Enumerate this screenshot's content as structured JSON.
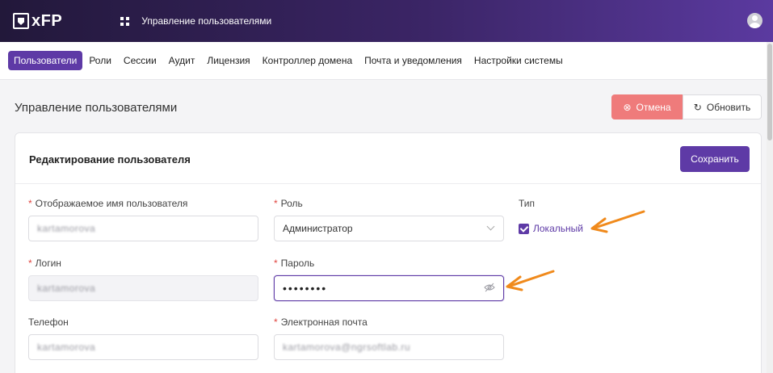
{
  "header": {
    "logo_text": "xFP",
    "app_title": "Управление пользователями"
  },
  "nav": {
    "items": [
      {
        "label": "Пользователи",
        "active": true
      },
      {
        "label": "Роли"
      },
      {
        "label": "Сессии"
      },
      {
        "label": "Аудит"
      },
      {
        "label": "Лицензия"
      },
      {
        "label": "Контроллер домена"
      },
      {
        "label": "Почта и уведомления"
      },
      {
        "label": "Настройки системы"
      }
    ]
  },
  "page": {
    "title": "Управление пользователями",
    "cancel_label": "Отмена",
    "refresh_label": "Обновить"
  },
  "card": {
    "title": "Редактирование пользователя",
    "save_label": "Сохранить"
  },
  "form": {
    "display_name": {
      "label": "Отображаемое имя пользователя",
      "required": "*",
      "value": "kartamorova"
    },
    "role": {
      "label": "Роль",
      "required": "*",
      "value": "Администратор"
    },
    "type": {
      "label": "Тип",
      "checkbox_label": "Локальный",
      "checked": true
    },
    "login": {
      "label": "Логин",
      "required": "*",
      "value": "kartamorova"
    },
    "password": {
      "label": "Пароль",
      "required": "*",
      "value": "••••••••"
    },
    "phone": {
      "label": "Телефон",
      "value": "kartamorova"
    },
    "email": {
      "label": "Электронная почта",
      "required": "*",
      "value": "kartamorova@ngrsoftlab.ru"
    }
  },
  "colors": {
    "accent": "#5e3aa6",
    "cancel": "#ef7b7b",
    "annotation_arrow": "#f08a1c"
  }
}
